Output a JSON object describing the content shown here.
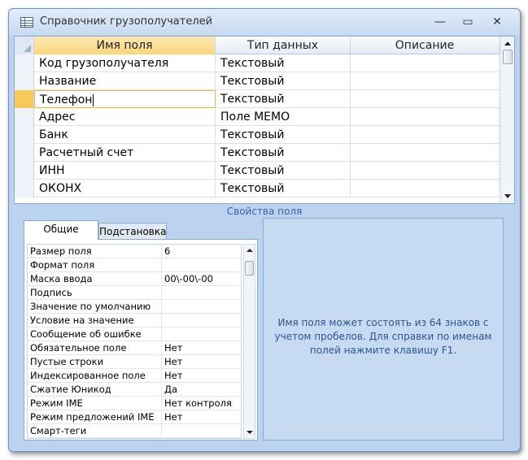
{
  "window": {
    "title": "Справочник грузополучателей",
    "controls": {
      "minimize": "—",
      "maximize": "▭",
      "close": "✕"
    }
  },
  "grid": {
    "columns": [
      "Имя поля",
      "Тип данных",
      "Описание"
    ],
    "rows": [
      {
        "name": "Код грузополучателя",
        "type": "Текстовый",
        "description": ""
      },
      {
        "name": "Название",
        "type": "Текстовый",
        "description": ""
      },
      {
        "name": "Телефон",
        "type": "Текстовый",
        "description": "",
        "current": true
      },
      {
        "name": "Адрес",
        "type": "Поле МЕМО",
        "description": ""
      },
      {
        "name": "Банк",
        "type": "Текстовый",
        "description": ""
      },
      {
        "name": "Расчетный счет",
        "type": "Текстовый",
        "description": ""
      },
      {
        "name": "ИНН",
        "type": "Текстовый",
        "description": ""
      },
      {
        "name": "ОКОНХ",
        "type": "Текстовый",
        "description": ""
      }
    ]
  },
  "properties": {
    "section_title": "Свойства поля",
    "tabs": [
      "Общие",
      "Подстановка"
    ],
    "rows": [
      {
        "label": "Размер поля",
        "value": "6"
      },
      {
        "label": "Формат поля",
        "value": ""
      },
      {
        "label": "Маска ввода",
        "value": "00\\-00\\-00"
      },
      {
        "label": "Подпись",
        "value": ""
      },
      {
        "label": "Значение по умолчанию",
        "value": ""
      },
      {
        "label": "Условие на значение",
        "value": ""
      },
      {
        "label": "Сообщение об ошибке",
        "value": ""
      },
      {
        "label": "Обязательное поле",
        "value": "Нет"
      },
      {
        "label": "Пустые строки",
        "value": "Нет"
      },
      {
        "label": "Индексированное поле",
        "value": "Нет"
      },
      {
        "label": "Сжатие Юникод",
        "value": "Да"
      },
      {
        "label": "Режим IME",
        "value": "Нет контроля"
      },
      {
        "label": "Режим предложений IME",
        "value": "Нет"
      },
      {
        "label": "Смарт-теги",
        "value": ""
      }
    ]
  },
  "help": {
    "text": "Имя поля может состоять из 64 знаков с учетом пробелов.  Для справки по именам полей нажмите клавишу F1."
  }
}
